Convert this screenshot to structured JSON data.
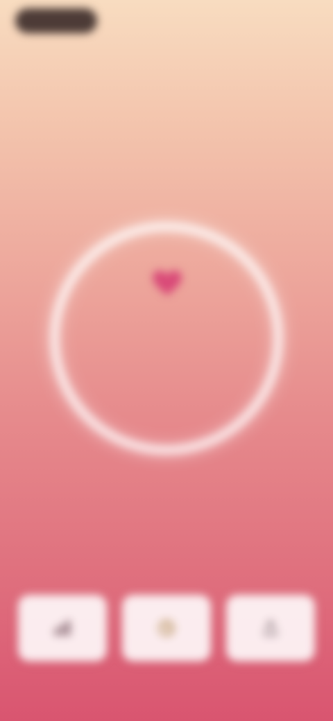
{
  "status_bar": {
    "pill_label": "",
    "right_text": ""
  },
  "header": {
    "title": "",
    "subtitle": ""
  },
  "heart_rate": {
    "value": "",
    "unit": ""
  },
  "cards": [
    {
      "label": "",
      "icon": "stats-icon"
    },
    {
      "label": "",
      "icon": "history-icon"
    },
    {
      "label": "",
      "icon": "share-icon"
    }
  ],
  "colors": {
    "gradient_top": "#f8dcc0",
    "gradient_bottom": "#d95570",
    "heart": "#d94a78",
    "ring": "#ffffff",
    "card_bg": "#ffffff"
  }
}
